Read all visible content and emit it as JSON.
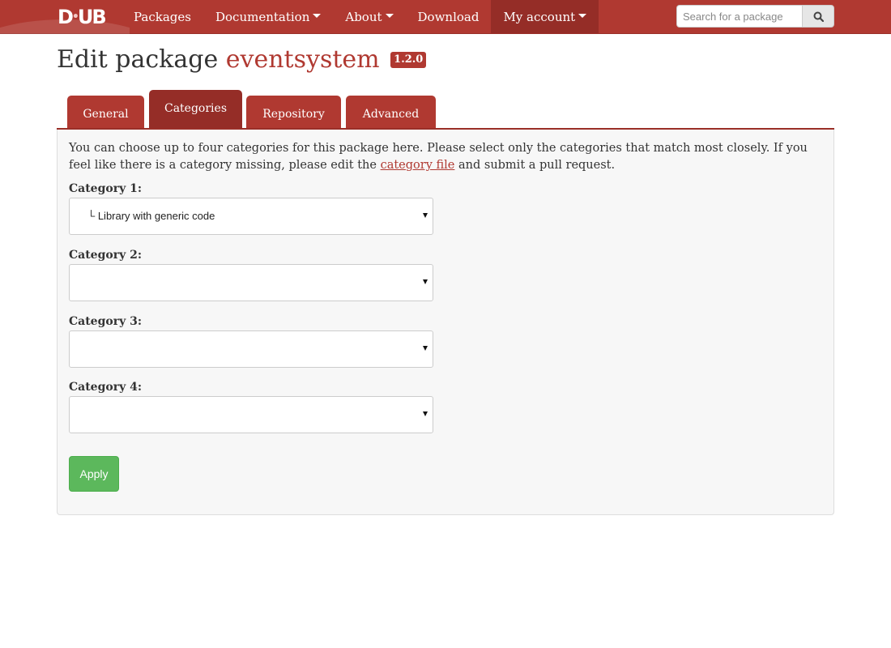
{
  "navbar": {
    "logo_text": "DUB",
    "items": [
      {
        "label": "Packages",
        "dropdown": false,
        "active": false
      },
      {
        "label": "Documentation",
        "dropdown": true,
        "active": false
      },
      {
        "label": "About",
        "dropdown": true,
        "active": false
      },
      {
        "label": "Download",
        "dropdown": false,
        "active": false
      },
      {
        "label": "My account",
        "dropdown": true,
        "active": true
      }
    ],
    "search": {
      "placeholder": "Search for a package",
      "value": "",
      "button_icon": "search-icon"
    },
    "colors": {
      "bar": "#b03931",
      "active": "#952d27"
    }
  },
  "header": {
    "title_prefix": "Edit package",
    "package_name": "eventsystem",
    "version": "1.2.0"
  },
  "tabs": [
    {
      "label": "General",
      "active": false
    },
    {
      "label": "Categories",
      "active": true
    },
    {
      "label": "Repository",
      "active": false
    },
    {
      "label": "Advanced",
      "active": false
    }
  ],
  "panel": {
    "intro_before_link": "You can choose up to four categories for this package here. Please select only the categories that match most closely. If you feel like there is a category missing, please edit the ",
    "link_text": "category file",
    "intro_after_link": " and submit a pull request.",
    "categories": [
      {
        "label": "Category 1:",
        "value": "└ Library with generic code"
      },
      {
        "label": "Category 2:",
        "value": ""
      },
      {
        "label": "Category 3:",
        "value": ""
      },
      {
        "label": "Category 4:",
        "value": ""
      }
    ],
    "apply_label": "Apply",
    "apply_color": "#5cb85c"
  }
}
